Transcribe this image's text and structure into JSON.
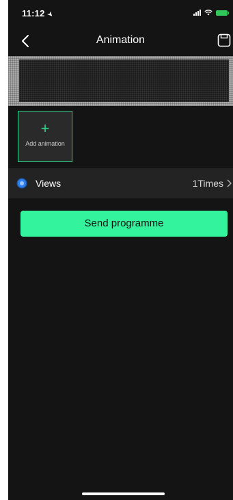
{
  "status_bar": {
    "time": "11:12",
    "location_arrow": "➤",
    "icons": [
      "signal-icon",
      "wifi-icon",
      "battery-charging-icon"
    ]
  },
  "nav": {
    "title": "Animation",
    "back_icon": "chevron-left-icon",
    "save_icon": "save-icon"
  },
  "add_tile": {
    "plus": "+",
    "label": "Add animation"
  },
  "views": {
    "label": "Views",
    "value": "1Times",
    "chevron": "chevron-right-icon"
  },
  "send_button": {
    "label": "Send programme"
  },
  "colors": {
    "accent": "#34f39d",
    "tile_border": "#2fd38a",
    "radio": "#2f80ed",
    "background": "#141414"
  }
}
